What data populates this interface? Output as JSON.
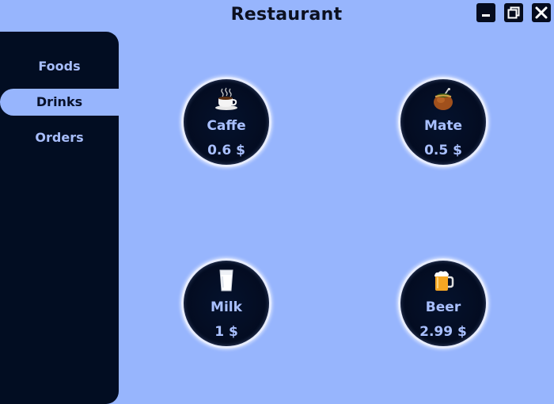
{
  "window": {
    "title": "Restaurant",
    "controls": {
      "minimize": "minimize-icon",
      "maximize": "restore-icon",
      "close": "close-icon"
    }
  },
  "sidebar": {
    "items": [
      {
        "label": "Foods",
        "active": false
      },
      {
        "label": "Drinks",
        "active": true
      },
      {
        "label": "Orders",
        "active": false
      }
    ]
  },
  "drinks": [
    {
      "name": "Caffe",
      "price": "0.6 $",
      "icon": "coffee-cup-icon"
    },
    {
      "name": "Mate",
      "price": "0.5 $",
      "icon": "mate-gourd-icon"
    },
    {
      "name": "Milk",
      "price": "1 $",
      "icon": "milk-glass-icon"
    },
    {
      "name": "Beer",
      "price": "2.99 $",
      "icon": "beer-mug-icon"
    }
  ],
  "colors": {
    "background": "#97b5fd",
    "sidebar": "#020d22",
    "card_text": "#a9c0ff"
  }
}
